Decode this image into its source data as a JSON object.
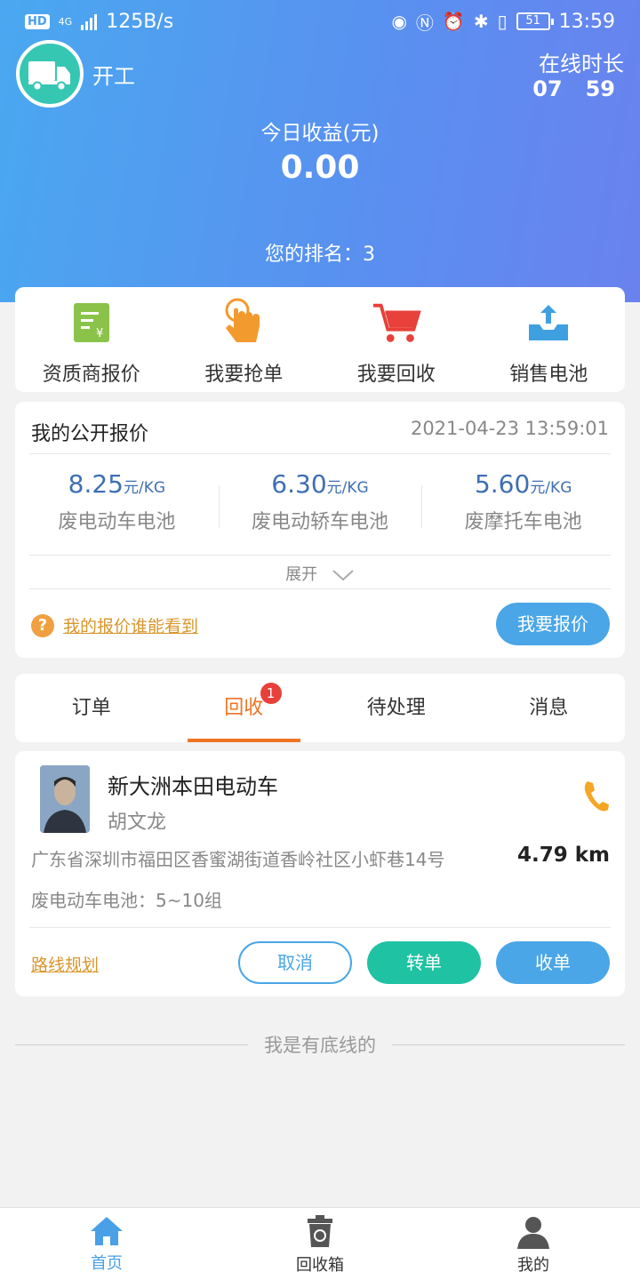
{
  "status_bar": {
    "hd": "HD",
    "net": "4G",
    "speed": "125B/s",
    "battery": "51",
    "time": "13:59"
  },
  "header": {
    "start_label": "开工",
    "online_label": "在线时长",
    "online_hours": "07",
    "online_minutes": "59",
    "earnings_label": "今日收益(元)",
    "earnings_value": "0.00",
    "rank_text": "您的排名：3"
  },
  "quick_actions": [
    {
      "label": "资质商报价",
      "icon": "price-doc-icon",
      "color": "#8bc34a"
    },
    {
      "label": "我要抢单",
      "icon": "tap-hand-icon",
      "color": "#f39a2f"
    },
    {
      "label": "我要回收",
      "icon": "cart-icon",
      "color": "#e8403a"
    },
    {
      "label": "销售电池",
      "icon": "upload-tray-icon",
      "color": "#3fa0e0"
    }
  ],
  "quote": {
    "title": "我的公开报价",
    "timestamp": "2021-04-23 13:59:01",
    "unit": "元/KG",
    "items": [
      {
        "price": "8.25",
        "name": "废电动车电池"
      },
      {
        "price": "6.30",
        "name": "废电动轿车电池"
      },
      {
        "price": "5.60",
        "name": "废摩托车电池"
      }
    ],
    "expand_label": "展开",
    "help_link": "我的报价谁能看到",
    "submit_label": "我要报价"
  },
  "tabs": [
    {
      "label": "订单"
    },
    {
      "label": "回收",
      "badge": "1"
    },
    {
      "label": "待处理"
    },
    {
      "label": "消息"
    }
  ],
  "order": {
    "shop_name": "新大洲本田电动车",
    "contact": "胡文龙",
    "address": "广东省深圳市福田区香蜜湖街道香岭社区小虾巷14号",
    "distance": "4.79 km",
    "category": "废电动车电池：5~10组",
    "route_label": "路线规划",
    "cancel_label": "取消",
    "transfer_label": "转单",
    "accept_label": "收单"
  },
  "baseline_text": "我是有底线的",
  "bottom_nav": [
    {
      "label": "首页",
      "icon": "home-icon"
    },
    {
      "label": "回收箱",
      "icon": "recycle-bin-icon"
    },
    {
      "label": "我的",
      "icon": "profile-icon"
    }
  ],
  "colors": {
    "accent": "#4aa6e6",
    "active_tab": "#ee7424",
    "link": "#d9962c",
    "transfer": "#1fc2a2"
  }
}
